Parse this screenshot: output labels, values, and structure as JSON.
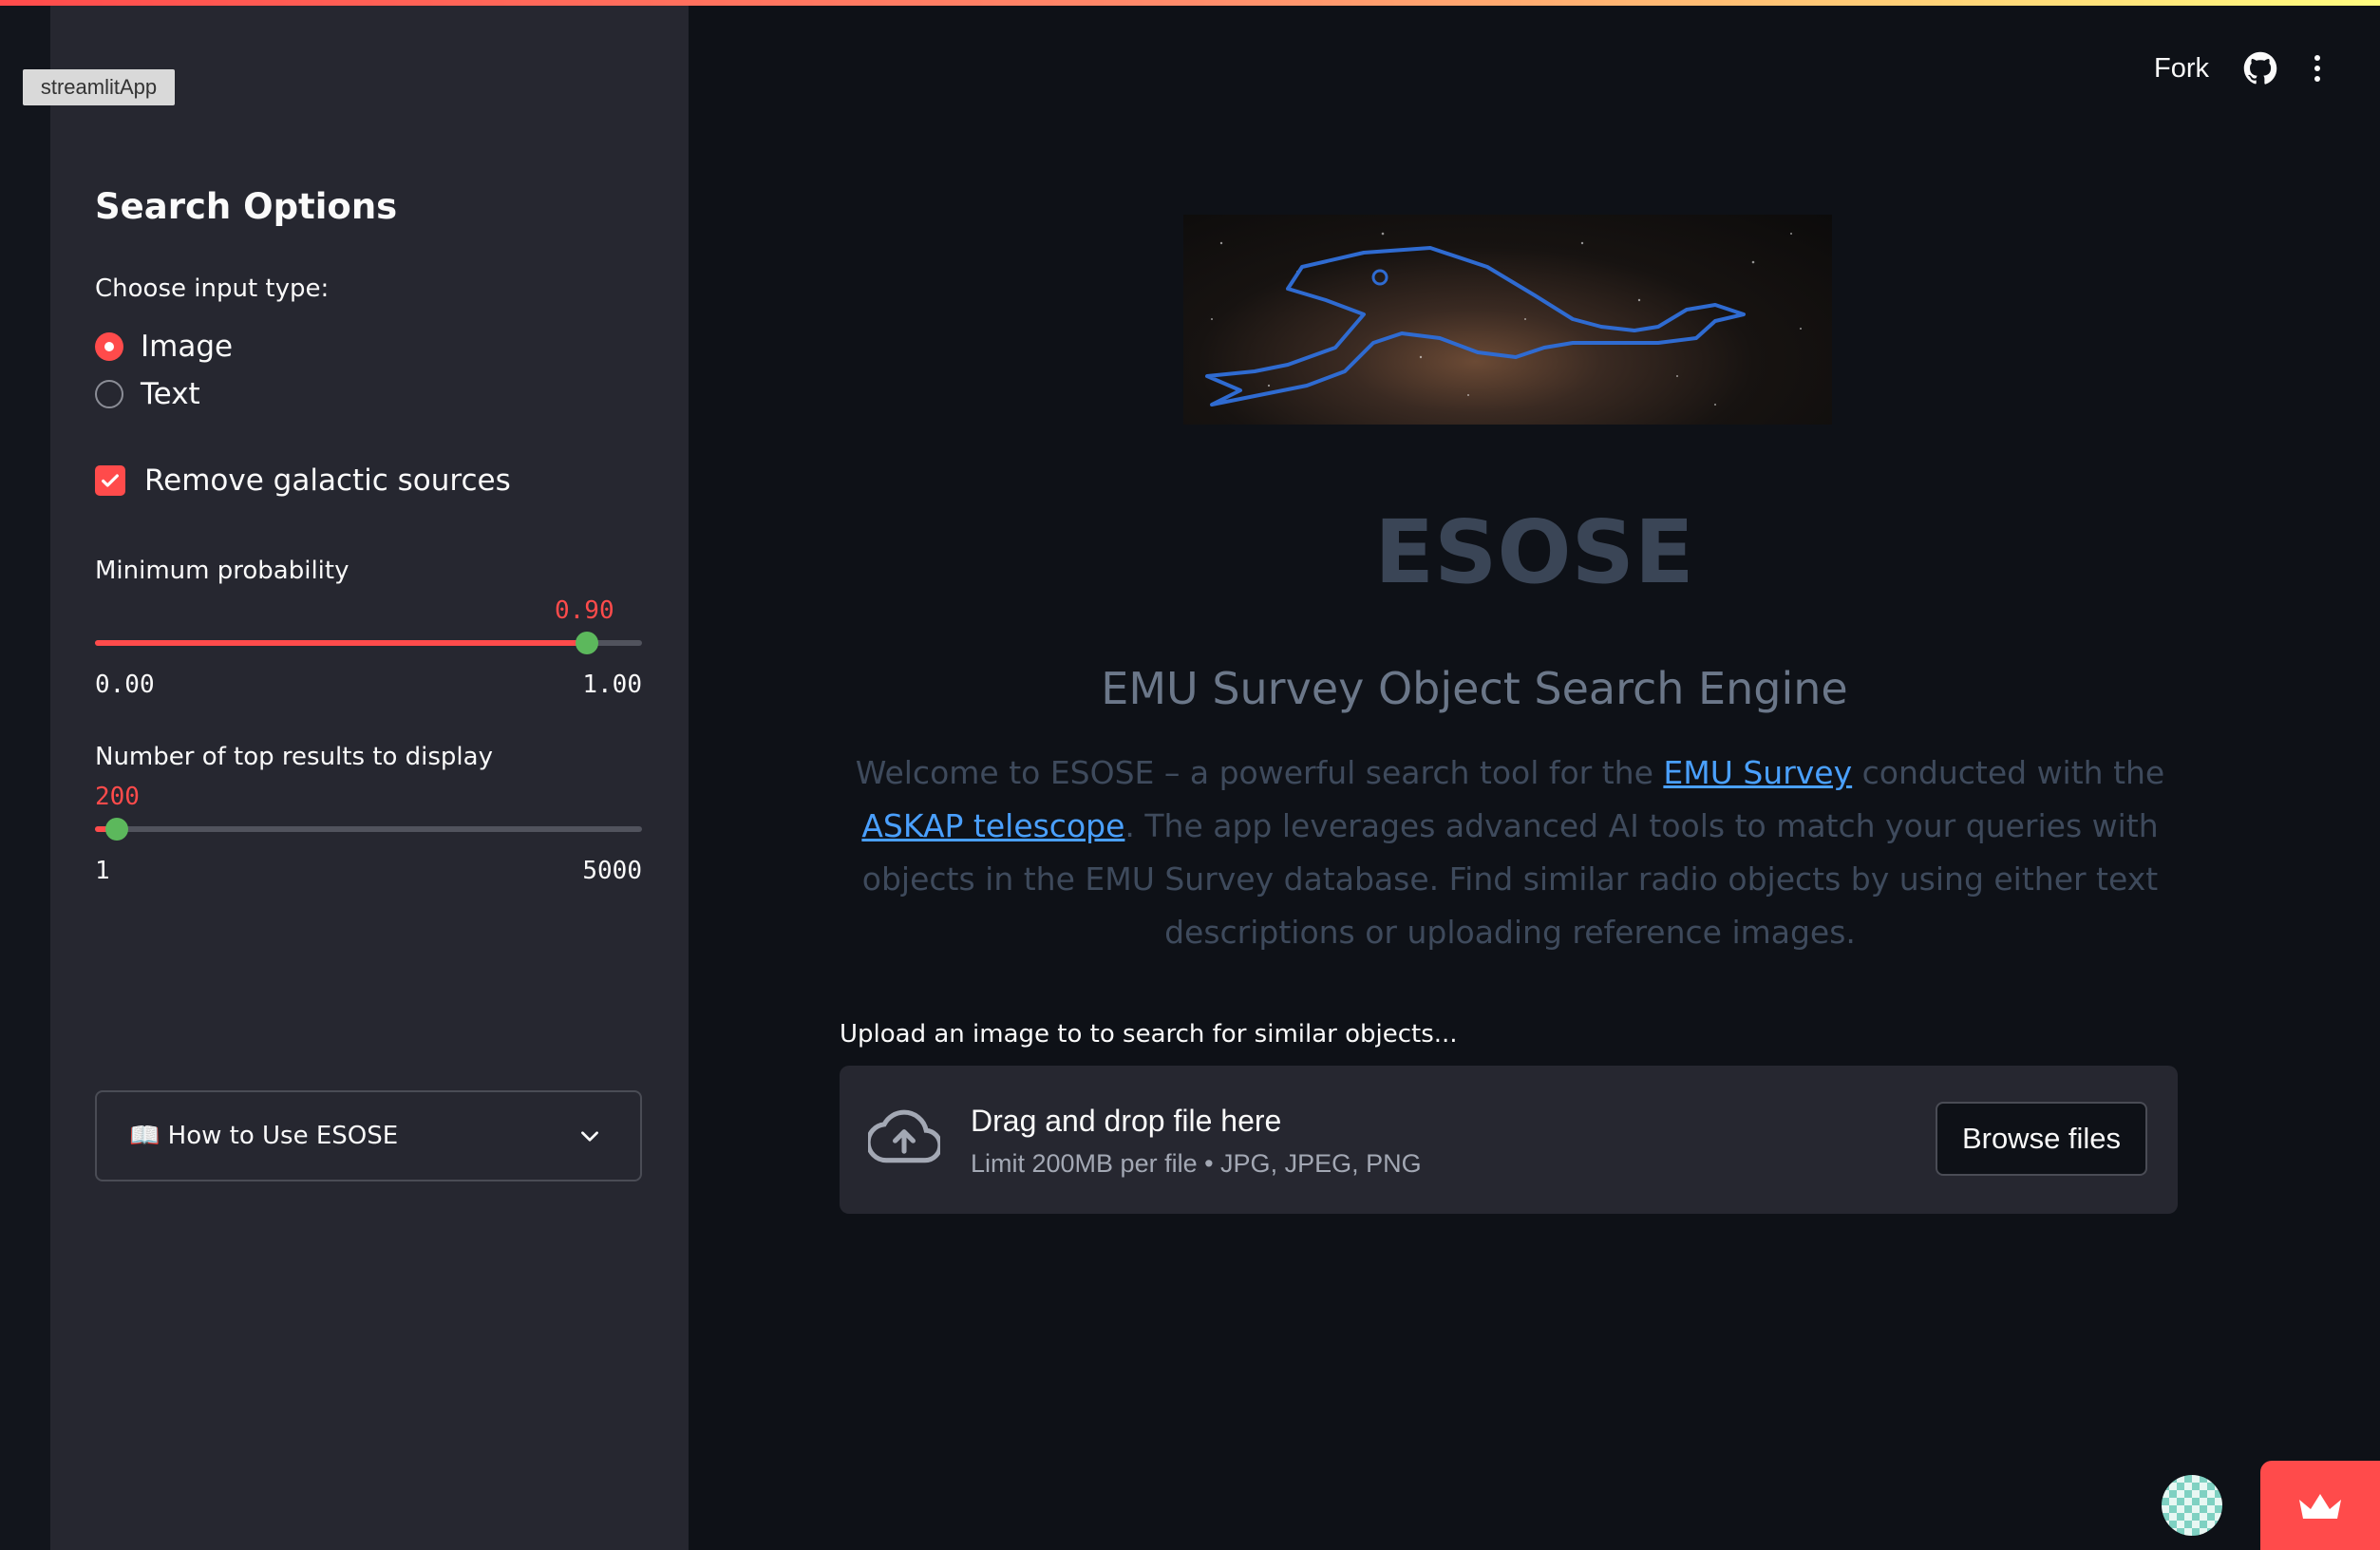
{
  "app_tag": "streamlitApp",
  "header": {
    "fork_label": "Fork"
  },
  "sidebar": {
    "title": "Search Options",
    "input_type_label": "Choose input type:",
    "input_options": [
      {
        "label": "Image",
        "selected": true
      },
      {
        "label": "Text",
        "selected": false
      }
    ],
    "remove_galactic_label": "Remove galactic sources",
    "remove_galactic_checked": true,
    "min_prob": {
      "label": "Minimum probability",
      "value": "0.90",
      "min": "0.00",
      "max": "1.00",
      "fraction": 0.9
    },
    "top_results": {
      "label": "Number of top results to display",
      "value": "200",
      "min": "1",
      "max": "5000",
      "fraction": 0.04
    },
    "expander_label": "📖 How to Use ESOSE"
  },
  "main": {
    "title": "ESOSE",
    "subtitle": "EMU Survey Object Search Engine",
    "welcome": {
      "part1": "Welcome to ESOSE – a powerful search tool for the ",
      "link1": "EMU Survey",
      "part2": " conducted with the ",
      "link2": "ASKAP telescope",
      "part3": ". The app leverages advanced AI tools to match your queries with objects in the EMU Survey database. Find similar radio objects by using either text descriptions or uploading reference images."
    },
    "upload_label": "Upload an image to to search for similar objects...",
    "dropzone": {
      "main_text": "Drag and drop file here",
      "sub_text": "Limit 200MB per file • JPG, JPEG, PNG",
      "browse_label": "Browse files"
    }
  },
  "colors": {
    "accent": "#ff4b4b",
    "thumb": "#5cb85c",
    "link": "#4aa0ff",
    "background": "#0e1117",
    "sidebar": "#262730"
  },
  "icons": [
    "github-icon",
    "more-vertical-icon",
    "cloud-upload-icon",
    "chevron-down-icon",
    "crown-icon"
  ]
}
